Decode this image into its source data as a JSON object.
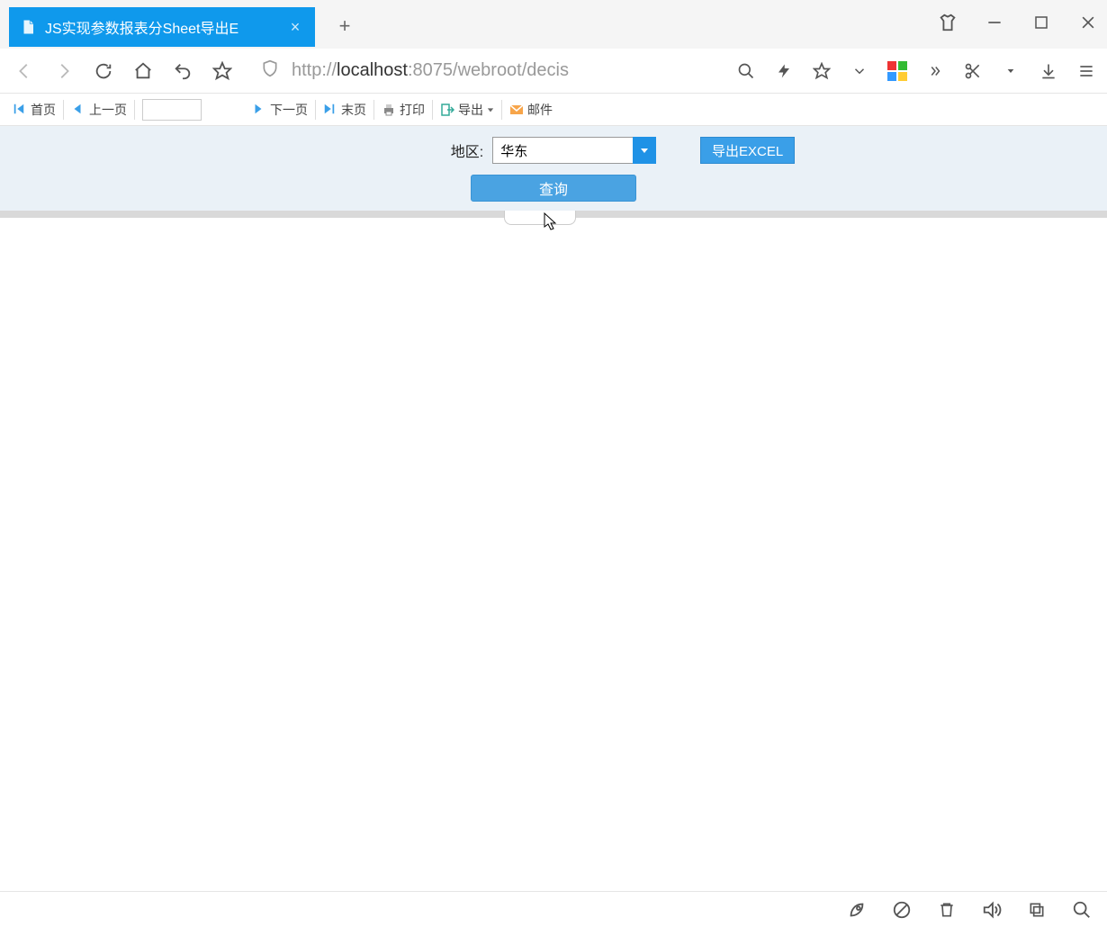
{
  "browser": {
    "tab_title": "JS实现参数报表分Sheet导出E",
    "url_prefix": "http://",
    "url_host": "localhost",
    "url_port": ":8075",
    "url_path": "/webroot/decis"
  },
  "report_toolbar": {
    "first": "首页",
    "prev": "上一页",
    "next": "下一页",
    "last": "末页",
    "print": "打印",
    "export": "导出",
    "mail": "邮件",
    "page_value": ""
  },
  "params": {
    "region_label": "地区:",
    "region_value": "华东",
    "export_excel": "导出EXCEL",
    "query": "查询"
  }
}
